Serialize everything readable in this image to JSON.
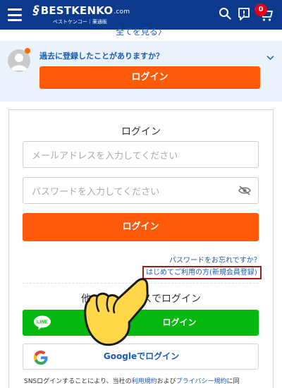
{
  "header": {
    "logo_text": "BESTKENKO",
    "logo_suffix": ".com",
    "logo_subtitle": "ベストケンコー｜薬通販",
    "cart_badge": "0",
    "icons": [
      "menu-icon",
      "search-icon",
      "notice-icon",
      "cart-icon"
    ]
  },
  "top": {
    "see_all": "全てを見る〉"
  },
  "past_panel": {
    "question": "過去に登録したことがありますか？",
    "login_label": "ログイン"
  },
  "login_card": {
    "title": "ログイン",
    "email_placeholder": "メールアドレスを入力してください",
    "password_placeholder": "パスワードを入力してください",
    "login_label": "ログイン",
    "forgot_password": "パスワードをお忘れですか？",
    "register_link": "はじめてご利用の方(新規会員登録)",
    "sns_title_left": "他",
    "sns_title_right": "スでログイン",
    "line_icon_text": "LINE",
    "line_label": "ログイン",
    "google_label": "Googleでログイン",
    "note_pre": "SNSログインすることにより、当社の",
    "note_link1": "利用規約",
    "note_mid": "および",
    "note_link2": "プライバシー規約",
    "note_post": "に同"
  },
  "colors": {
    "header_bg": "#0b3a8c",
    "accent_orange": "#ff5a0a",
    "link_blue": "#1a5bb8",
    "line_green": "#06b90e",
    "badge_red": "#e60012",
    "highlight_box": "#a01a1a"
  }
}
